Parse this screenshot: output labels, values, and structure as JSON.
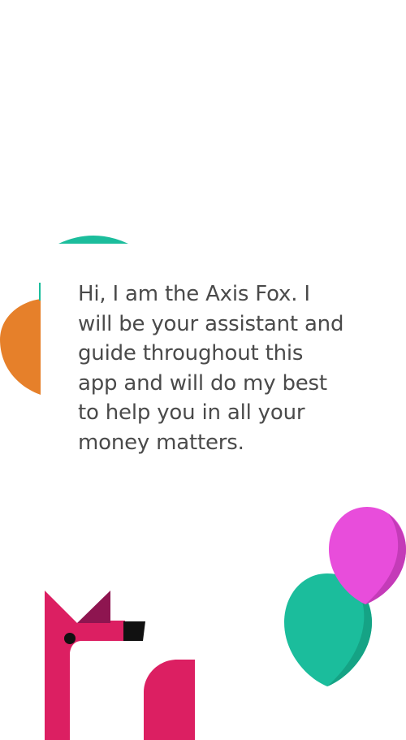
{
  "onboarding": {
    "message": "Hi, I am the Axis Fox. I will be your assistant and guide throughout this app and will do my best to help you in all your money matters."
  },
  "colors": {
    "background": "#ffffff",
    "text": "#4a4a4a",
    "teal": "#1bbd9c",
    "orange": "#e6802a",
    "pink_balloon": "#e84ddb",
    "fox_body": "#dc1f62",
    "fox_ear_dark": "#8e1550",
    "fox_nose": "#111111"
  },
  "illustrations": {
    "mascot": "axis-fox-icon",
    "balloons": [
      "teal-balloon-icon",
      "pink-balloon-icon"
    ]
  }
}
